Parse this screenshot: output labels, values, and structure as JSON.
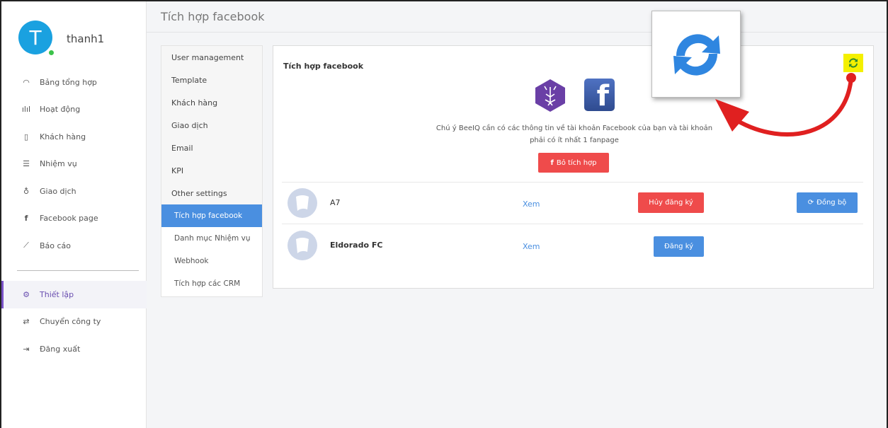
{
  "user": {
    "initial": "T",
    "name": "thanh1"
  },
  "nav": [
    {
      "icon": "dashboard-icon",
      "label": "Bảng tổng hợp"
    },
    {
      "icon": "activity-icon",
      "label": "Hoạt động"
    },
    {
      "icon": "customers-icon",
      "label": "Khách hàng"
    },
    {
      "icon": "tasks-icon",
      "label": "Nhiệm vụ"
    },
    {
      "icon": "deals-icon",
      "label": "Giao dịch"
    },
    {
      "icon": "facebook-icon",
      "label": "Facebook page"
    },
    {
      "icon": "report-icon",
      "label": "Báo cáo"
    }
  ],
  "nav_bottom": [
    {
      "icon": "settings-icon",
      "label": "Thiết lập",
      "active": true
    },
    {
      "icon": "switch-icon",
      "label": "Chuyển công ty"
    },
    {
      "icon": "logout-icon",
      "label": "Đăng xuất"
    }
  ],
  "page_title": "Tích hợp facebook",
  "settings_menu": [
    "User management",
    "Template",
    "Khách hàng",
    "Giao dịch",
    "Email",
    "KPI",
    "Other settings",
    "Tích hợp facebook",
    "Danh mục Nhiệm vụ",
    "Webhook",
    "Tích hợp các CRM"
  ],
  "card": {
    "title": "Tích hợp facebook",
    "note_line1": "Chú ý BeeIQ cần có các thông tin về tài khoản Facebook của bạn và tài khoản",
    "note_line2": "phải có ít nhất 1 fanpage",
    "unlink_label": "Bỏ tích hợp",
    "fb_glyph": "f"
  },
  "pages": [
    {
      "name": "A7",
      "view": "Xem",
      "unsubscribe": "Hủy đăng ký",
      "sync": "Đồng bộ"
    },
    {
      "name": "Eldorado FC",
      "view": "Xem",
      "register": "Đăng ký"
    }
  ],
  "colors": {
    "accent": "#4a8fe0",
    "danger": "#ef4b4b",
    "highlight": "#f4f000",
    "annotation_arrow": "#e02020",
    "active_nav": "#7a52c7"
  }
}
